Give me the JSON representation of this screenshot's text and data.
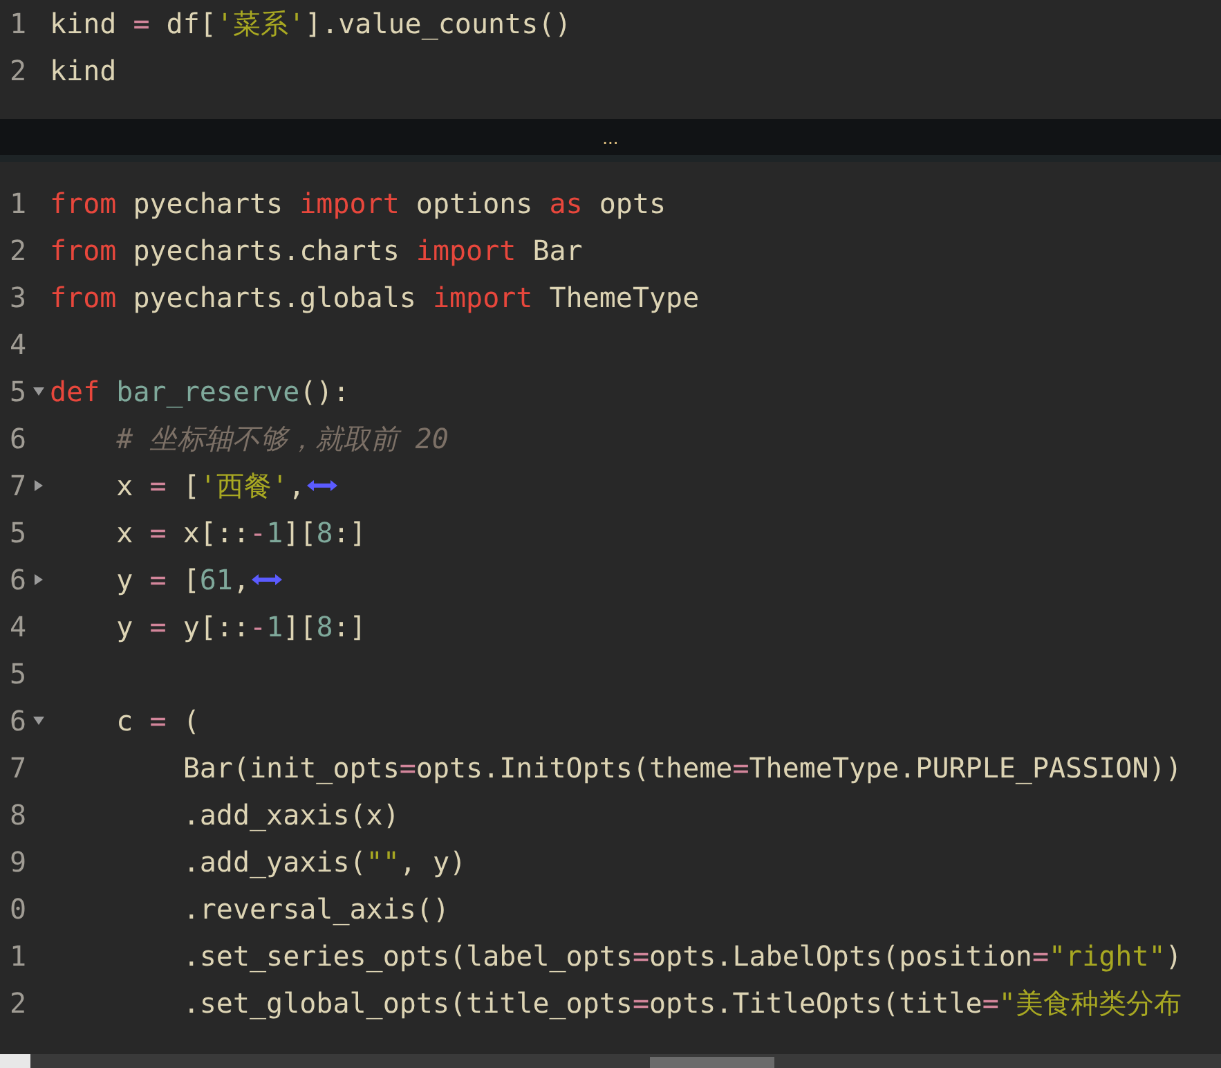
{
  "cells": [
    {
      "lines": [
        {
          "number": "1",
          "tokens": [
            {
              "kind": "text",
              "text": "kind "
            },
            {
              "kind": "op",
              "text": "="
            },
            {
              "kind": "text",
              "text": " df["
            },
            {
              "kind": "str",
              "text": "'菜系'"
            },
            {
              "kind": "text",
              "text": "].value_counts()"
            }
          ]
        },
        {
          "number": "2",
          "tokens": [
            {
              "kind": "text",
              "text": "kind"
            }
          ]
        }
      ]
    },
    {
      "lines": [
        {
          "number": "1",
          "tokens": [
            {
              "kind": "kw",
              "text": "from"
            },
            {
              "kind": "text",
              "text": " pyecharts "
            },
            {
              "kind": "kw",
              "text": "import"
            },
            {
              "kind": "text",
              "text": " options "
            },
            {
              "kind": "kw",
              "text": "as"
            },
            {
              "kind": "text",
              "text": " opts"
            }
          ]
        },
        {
          "number": "2",
          "tokens": [
            {
              "kind": "kw",
              "text": "from"
            },
            {
              "kind": "text",
              "text": " pyecharts.charts "
            },
            {
              "kind": "kw",
              "text": "import"
            },
            {
              "kind": "text",
              "text": " Bar"
            }
          ]
        },
        {
          "number": "3",
          "tokens": [
            {
              "kind": "kw",
              "text": "from"
            },
            {
              "kind": "text",
              "text": " pyecharts.globals "
            },
            {
              "kind": "kw",
              "text": "import"
            },
            {
              "kind": "text",
              "text": " ThemeType"
            }
          ]
        },
        {
          "number": "4"
        },
        {
          "number": "5",
          "expanded": true,
          "tokens": [
            {
              "kind": "kw",
              "text": "def "
            },
            {
              "kind": "name",
              "text": "bar_reserve"
            },
            {
              "kind": "text",
              "text": "():"
            }
          ]
        },
        {
          "number": "6",
          "tokens": [
            {
              "kind": "comment",
              "text": "    # 坐标轴不够，就取前 20"
            }
          ]
        },
        {
          "number": "7",
          "expanded": false,
          "tokens": [
            {
              "kind": "text",
              "text": "    x "
            },
            {
              "kind": "op",
              "text": "="
            },
            {
              "kind": "text",
              "text": " ["
            },
            {
              "kind": "str",
              "text": "'西餐'"
            },
            {
              "kind": "text",
              "text": ","
            },
            {
              "kind": "folded"
            }
          ]
        },
        {
          "number": "5",
          "tokens": [
            {
              "kind": "text",
              "text": "    x "
            },
            {
              "kind": "op",
              "text": "="
            },
            {
              "kind": "text",
              "text": " x[::"
            },
            {
              "kind": "op",
              "text": "-"
            },
            {
              "kind": "name",
              "text": "1"
            },
            {
              "kind": "text",
              "text": "]["
            },
            {
              "kind": "name",
              "text": "8"
            },
            {
              "kind": "text",
              "text": ":]"
            }
          ]
        },
        {
          "number": "6",
          "expanded": false,
          "tokens": [
            {
              "kind": "text",
              "text": "    y "
            },
            {
              "kind": "op",
              "text": "="
            },
            {
              "kind": "text",
              "text": " ["
            },
            {
              "kind": "name",
              "text": "61"
            },
            {
              "kind": "text",
              "text": ","
            },
            {
              "kind": "folded"
            }
          ]
        },
        {
          "number": "4",
          "tokens": [
            {
              "kind": "text",
              "text": "    y "
            },
            {
              "kind": "op",
              "text": "="
            },
            {
              "kind": "text",
              "text": " y[::"
            },
            {
              "kind": "op",
              "text": "-"
            },
            {
              "kind": "name",
              "text": "1"
            },
            {
              "kind": "text",
              "text": "]["
            },
            {
              "kind": "name",
              "text": "8"
            },
            {
              "kind": "text",
              "text": ":]"
            }
          ]
        },
        {
          "number": "5"
        },
        {
          "number": "6",
          "expanded": true,
          "tokens": [
            {
              "kind": "text",
              "text": "    c "
            },
            {
              "kind": "op",
              "text": "="
            },
            {
              "kind": "text",
              "text": " ("
            }
          ]
        },
        {
          "number": "7",
          "tokens": [
            {
              "kind": "text",
              "text": "        Bar(init_opts"
            },
            {
              "kind": "op",
              "text": "="
            },
            {
              "kind": "text",
              "text": "opts.InitOpts(theme"
            },
            {
              "kind": "op",
              "text": "="
            },
            {
              "kind": "text",
              "text": "ThemeType.PURPLE_PASSION))"
            }
          ]
        },
        {
          "number": "8",
          "tokens": [
            {
              "kind": "text",
              "text": "        .add_xaxis(x)"
            }
          ]
        },
        {
          "number": "9",
          "tokens": [
            {
              "kind": "text",
              "text": "        .add_yaxis("
            },
            {
              "kind": "str",
              "text": "\"\""
            },
            {
              "kind": "text",
              "text": ", y)"
            }
          ]
        },
        {
          "number": "0",
          "tokens": [
            {
              "kind": "text",
              "text": "        .reversal_axis()"
            }
          ]
        },
        {
          "number": "1",
          "tokens": [
            {
              "kind": "text",
              "text": "        .set_series_opts(label_opts"
            },
            {
              "kind": "op",
              "text": "="
            },
            {
              "kind": "text",
              "text": "opts.LabelOpts(position"
            },
            {
              "kind": "op",
              "text": "="
            },
            {
              "kind": "str",
              "text": "\"right\""
            },
            {
              "kind": "text",
              "text": ")"
            }
          ]
        },
        {
          "number": "2",
          "tokens": [
            {
              "kind": "text",
              "text": "        .set_global_opts(title_opts"
            },
            {
              "kind": "op",
              "text": "="
            },
            {
              "kind": "text",
              "text": "opts.TitleOpts(title"
            },
            {
              "kind": "op",
              "text": "="
            },
            {
              "kind": "str",
              "text": "\"美食种类分布"
            }
          ]
        }
      ]
    }
  ],
  "collapsed_output": {
    "label": "..."
  }
}
